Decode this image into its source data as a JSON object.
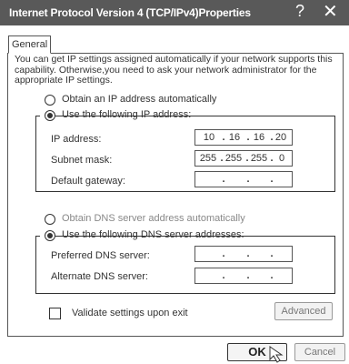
{
  "window": {
    "title": "Internet Protocol Version 4 (TCP/IPv4)Properties",
    "help": "?",
    "close": "✕"
  },
  "tabs": [
    {
      "label": "General"
    }
  ],
  "description": "You can get IP settings assigned automatically if your network supports this capability. Otherwise,you need to ask your network administrator for the appropriate IP settings.",
  "ip_section": {
    "auto_label": "Obtain an IP address automatically",
    "manual_label": "Use the following IP address:",
    "selected": "manual",
    "fields": {
      "ip": {
        "label": "IP address:",
        "octets": [
          "10",
          "16",
          "16",
          "20"
        ]
      },
      "mask": {
        "label": "Subnet mask:",
        "octets": [
          "255",
          "255",
          "255",
          "0"
        ]
      },
      "gateway": {
        "label": "Default gateway:",
        "octets": [
          "",
          "",
          "",
          ""
        ]
      }
    }
  },
  "dns_section": {
    "auto_label": "Obtain DNS  server address automatically",
    "manual_label": "Use the following DNS server addresses:",
    "selected": "manual",
    "fields": {
      "preferred": {
        "label": "Preferred DNS server:",
        "octets": [
          "",
          "",
          "",
          ""
        ]
      },
      "alternate": {
        "label": "Alternate DNS server:",
        "octets": [
          "",
          "",
          "",
          ""
        ]
      }
    }
  },
  "validate": {
    "label": "Validate settings upon exit",
    "checked": false
  },
  "buttons": {
    "advanced": "Advanced",
    "ok": "OK",
    "cancel": "Cancel"
  },
  "dot": "."
}
